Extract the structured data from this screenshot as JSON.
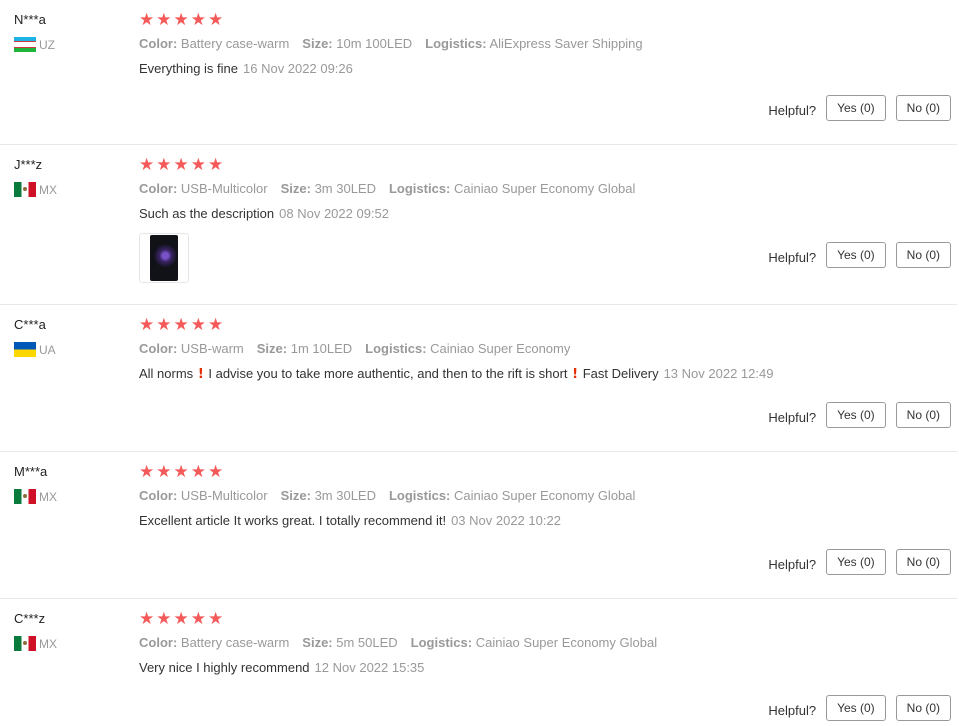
{
  "labels": {
    "color": "Color:",
    "size": "Size:",
    "logistics": "Logistics:",
    "helpful": "Helpful?",
    "yes": "Yes (0)",
    "no": "No (0)"
  },
  "star_icon": "star-icon",
  "accent_color": "#f55a5a",
  "reviews": [
    {
      "user": "N***a",
      "country": "UZ",
      "stars": 5,
      "color": "Battery case-warm",
      "size": "10m 100LED",
      "logistics": "AliExpress Saver Shipping",
      "text": "Everything is fine",
      "date": "16 Nov 2022 09:26"
    },
    {
      "user": "J***z",
      "country": "MX",
      "stars": 5,
      "color": "USB-Multicolor",
      "size": "3m 30LED",
      "logistics": "Cainiao Super Economy Global",
      "text": "Such as the description",
      "date": "08 Nov 2022 09:52",
      "has_photo": true
    },
    {
      "user": "C***a",
      "country": "UA",
      "stars": 5,
      "color": "USB-warm",
      "size": "1m 10LED",
      "logistics": "Cainiao Super Economy",
      "text_parts": [
        "All norms",
        "I advise you to take more authentic, and then to the rift is short",
        "Fast Delivery"
      ],
      "date": "13 Nov 2022 12:49"
    },
    {
      "user": "M***a",
      "country": "MX",
      "stars": 5,
      "color": "USB-Multicolor",
      "size": "3m 30LED",
      "logistics": "Cainiao Super Economy Global",
      "text": "Excellent article It works great. I totally recommend it!",
      "date": "03 Nov 2022 10:22"
    },
    {
      "user": "C***z",
      "country": "MX",
      "stars": 5,
      "color": "Battery case-warm",
      "size": "5m 50LED",
      "logistics": "Cainiao Super Economy Global",
      "text": "Very nice I highly recommend",
      "date": "12 Nov 2022 15:35"
    }
  ]
}
